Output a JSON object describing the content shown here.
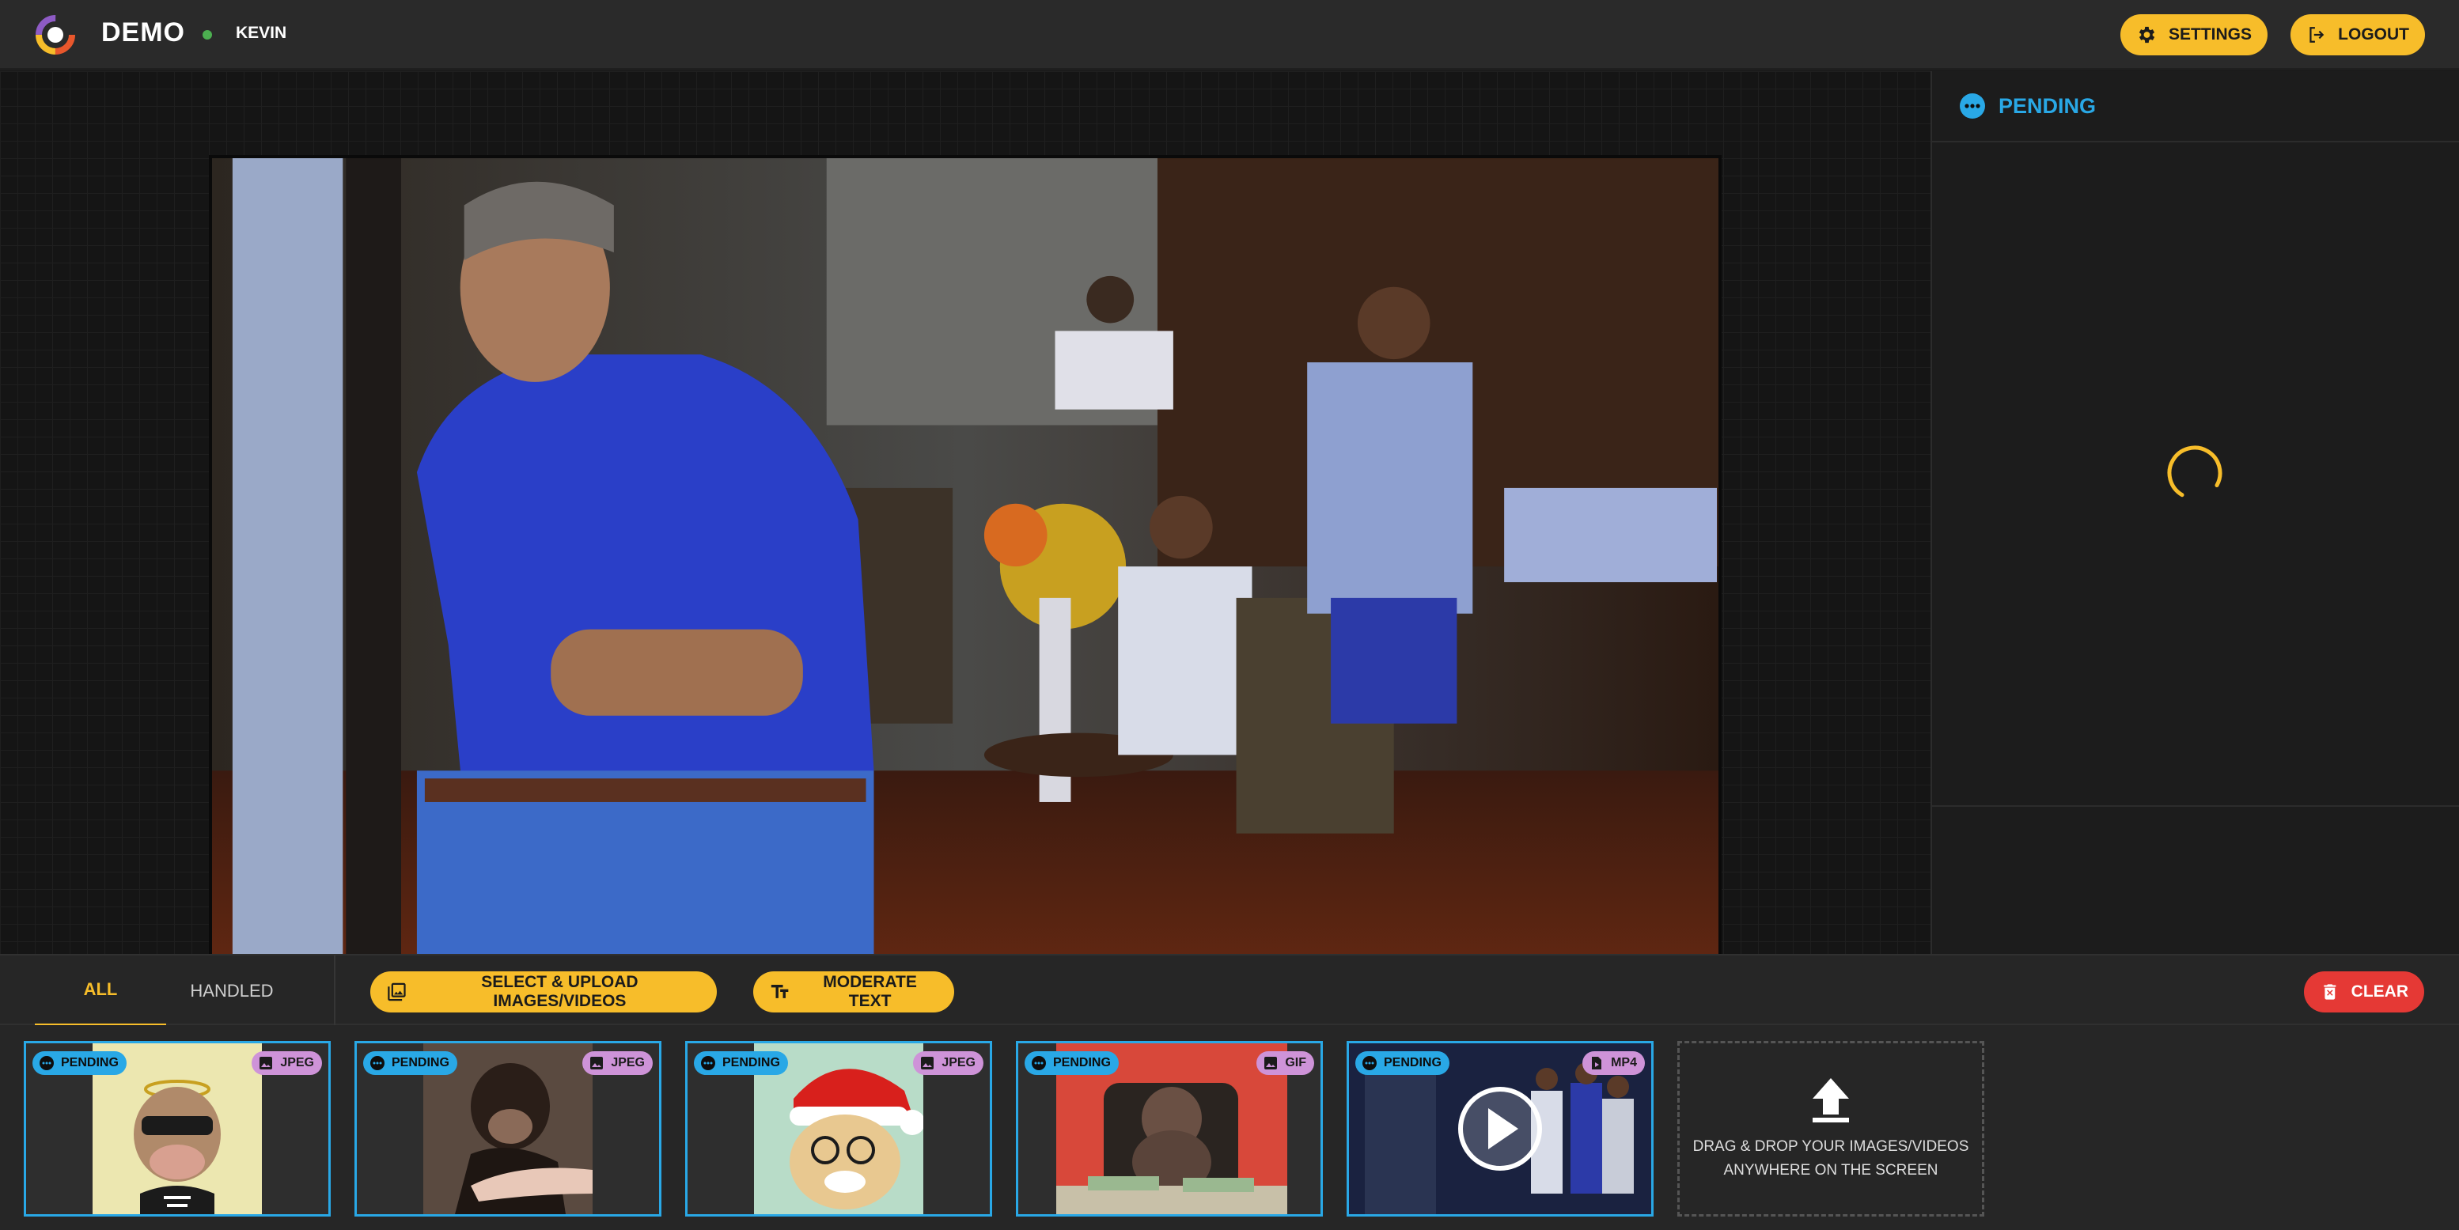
{
  "header": {
    "app_name": "DEMO",
    "username": "KEVIN",
    "online_color": "#4caf50",
    "settings_label": "SETTINGS",
    "logout_label": "LOGOUT",
    "accent_color": "#f7bd2a"
  },
  "side_panel": {
    "status": "PENDING",
    "status_color": "#29a8e6",
    "status_icon": "more-horiz-icon",
    "loading": true
  },
  "toolbar": {
    "tabs": [
      {
        "label": "ALL",
        "active": true
      },
      {
        "label": "HANDLED",
        "active": false
      }
    ],
    "upload_label": "SELECT & UPLOAD IMAGES/VIDEOS",
    "moderate_label": "MODERATE TEXT",
    "clear_label": "CLEAR"
  },
  "thumbnails": [
    {
      "status": "PENDING",
      "type": "JPEG",
      "icon": "image-icon"
    },
    {
      "status": "PENDING",
      "type": "JPEG",
      "icon": "image-icon"
    },
    {
      "status": "PENDING",
      "type": "JPEG",
      "icon": "image-icon"
    },
    {
      "status": "PENDING",
      "type": "GIF",
      "icon": "image-icon"
    },
    {
      "status": "PENDING",
      "type": "MP4",
      "icon": "video-file-icon"
    }
  ],
  "dropzone": {
    "line1": "DRAG & DROP YOUR IMAGES/VIDEOS",
    "line2": "ANYWHERE ON THE SCREEN",
    "icon": "upload-icon"
  }
}
